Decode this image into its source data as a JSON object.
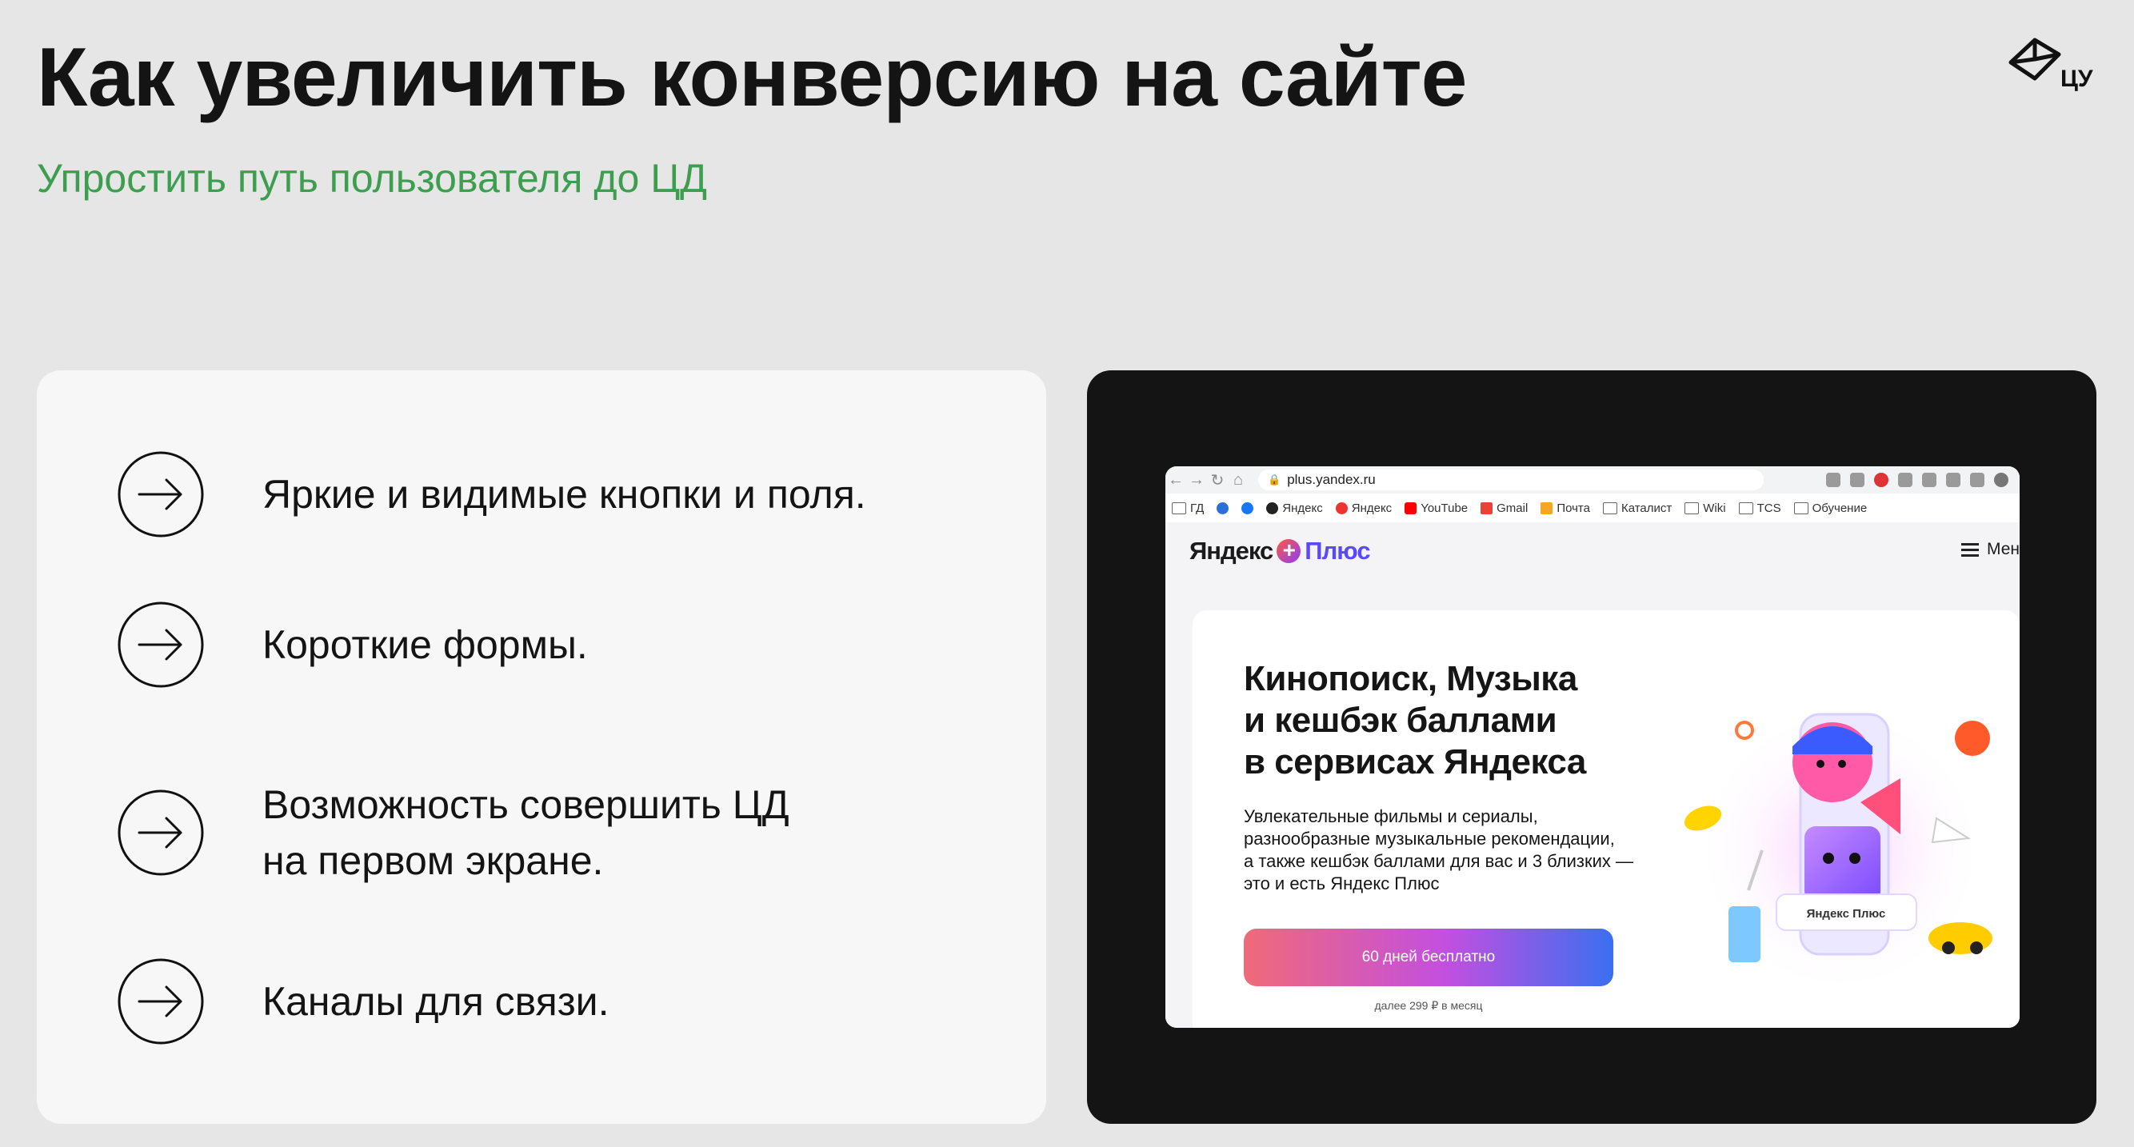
{
  "header": {
    "title": "Как увеличить конверсию на сайте",
    "subtitle": "Упростить путь пользователя до ЦД",
    "logo_text": "ЦУ"
  },
  "checklist": [
    {
      "icon": "arrow-right-circle-icon",
      "lines": [
        "Яркие и видимые кнопки и поля."
      ]
    },
    {
      "icon": "arrow-right-circle-icon",
      "lines": [
        "Короткие формы."
      ]
    },
    {
      "icon": "arrow-right-circle-icon",
      "lines": [
        "Возможность совершить ЦД",
        "на первом экране."
      ]
    },
    {
      "icon": "arrow-right-circle-icon",
      "lines": [
        "Каналы для связи."
      ]
    }
  ],
  "screenshot": {
    "browser": {
      "url": "plus.yandex.ru",
      "bookmarks": [
        "ГД",
        "Яндекс",
        "Яндекс",
        "YouTube",
        "Gmail",
        "Почта",
        "Каталист",
        "Wiki",
        "TCS",
        "Обучение"
      ]
    },
    "site": {
      "logo_part1": "Яндекс",
      "logo_plus_symbol": "+",
      "logo_part2": "Плюс",
      "menu_label": "Мен",
      "hero_title": [
        "Кинопоиск, Музыка",
        "и кешбэк баллами",
        "в сервисах Яндекса"
      ],
      "hero_desc": [
        "Увлекательные фильмы и сериалы,",
        "разнообразные музыкальные рекомендации,",
        "а также кешбэк баллами для вас и 3 близких —",
        "это и есть Яндекс Плюс"
      ],
      "cta_label": "60 дней бесплатно",
      "cta_sub": "далее 299 ₽ в месяц",
      "illus_caption": "Яндекс Плюс"
    }
  },
  "colors": {
    "background": "#e6e6e6",
    "accent_green": "#3e9e4f",
    "card_light": "#f7f7f7",
    "card_dark": "#141414"
  }
}
